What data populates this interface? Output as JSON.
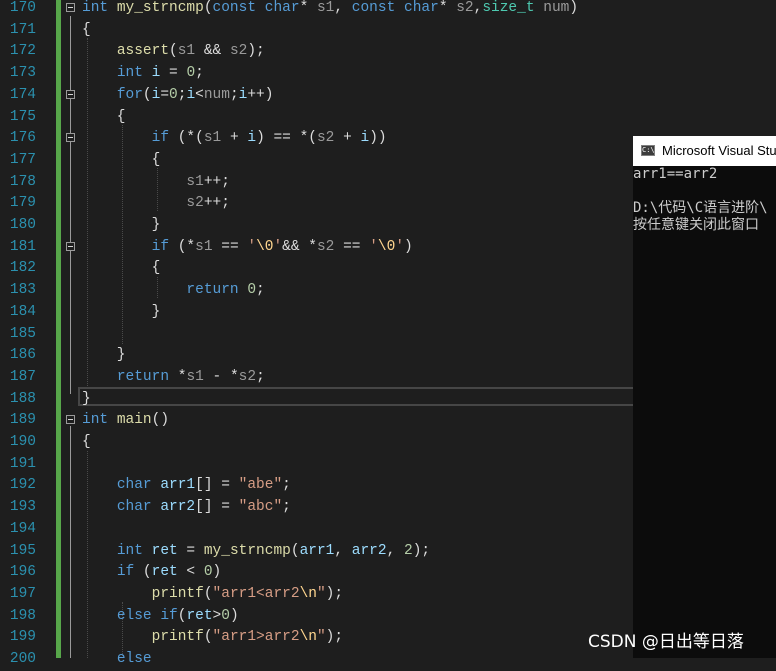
{
  "editor": {
    "lines": [
      {
        "num": "170",
        "parts": [
          [
            "kw",
            "int"
          ],
          [
            "t",
            " "
          ],
          [
            "fn",
            "my_strncmp"
          ],
          [
            "t",
            "("
          ],
          [
            "kw",
            "const"
          ],
          [
            "t",
            " "
          ],
          [
            "kw",
            "char"
          ],
          [
            "t",
            "* "
          ],
          [
            "pm",
            "s1"
          ],
          [
            "t",
            ", "
          ],
          [
            "kw",
            "const"
          ],
          [
            "t",
            " "
          ],
          [
            "kw",
            "char"
          ],
          [
            "t",
            "* "
          ],
          [
            "pm",
            "s2"
          ],
          [
            "t",
            ","
          ],
          [
            "tp",
            "size_t"
          ],
          [
            "t",
            " "
          ],
          [
            "pm",
            "num"
          ],
          [
            "t",
            ")"
          ]
        ]
      },
      {
        "num": "171",
        "parts": [
          [
            "t",
            "{"
          ]
        ]
      },
      {
        "num": "172",
        "parts": [
          [
            "t",
            "    "
          ],
          [
            "fn",
            "assert"
          ],
          [
            "t",
            "("
          ],
          [
            "pm",
            "s1"
          ],
          [
            "t",
            " && "
          ],
          [
            "pm",
            "s2"
          ],
          [
            "t",
            ");"
          ]
        ]
      },
      {
        "num": "173",
        "parts": [
          [
            "t",
            "    "
          ],
          [
            "kw",
            "int"
          ],
          [
            "t",
            " "
          ],
          [
            "vr",
            "i"
          ],
          [
            "t",
            " = "
          ],
          [
            "nm",
            "0"
          ],
          [
            "t",
            ";"
          ]
        ]
      },
      {
        "num": "174",
        "parts": [
          [
            "t",
            "    "
          ],
          [
            "kw",
            "for"
          ],
          [
            "t",
            "("
          ],
          [
            "vr",
            "i"
          ],
          [
            "t",
            "="
          ],
          [
            "nm",
            "0"
          ],
          [
            "t",
            ";"
          ],
          [
            "vr",
            "i"
          ],
          [
            "t",
            "<"
          ],
          [
            "pm",
            "num"
          ],
          [
            "t",
            ";"
          ],
          [
            "vr",
            "i"
          ],
          [
            "t",
            "++)"
          ]
        ]
      },
      {
        "num": "175",
        "parts": [
          [
            "t",
            "    {"
          ]
        ]
      },
      {
        "num": "176",
        "parts": [
          [
            "t",
            "        "
          ],
          [
            "kw",
            "if"
          ],
          [
            "t",
            " (*("
          ],
          [
            "pm",
            "s1"
          ],
          [
            "t",
            " + "
          ],
          [
            "vr",
            "i"
          ],
          [
            "t",
            ") == *("
          ],
          [
            "pm",
            "s2"
          ],
          [
            "t",
            " + "
          ],
          [
            "vr",
            "i"
          ],
          [
            "t",
            "))"
          ]
        ]
      },
      {
        "num": "177",
        "parts": [
          [
            "t",
            "        {"
          ]
        ]
      },
      {
        "num": "178",
        "parts": [
          [
            "t",
            "            "
          ],
          [
            "pm",
            "s1"
          ],
          [
            "t",
            "++;"
          ]
        ]
      },
      {
        "num": "179",
        "parts": [
          [
            "t",
            "            "
          ],
          [
            "pm",
            "s2"
          ],
          [
            "t",
            "++;"
          ]
        ]
      },
      {
        "num": "180",
        "parts": [
          [
            "t",
            "        }"
          ]
        ]
      },
      {
        "num": "181",
        "parts": [
          [
            "t",
            "        "
          ],
          [
            "kw",
            "if"
          ],
          [
            "t",
            " (*"
          ],
          [
            "pm",
            "s1"
          ],
          [
            "t",
            " == "
          ],
          [
            "st",
            "'"
          ],
          [
            "esc",
            "\\0"
          ],
          [
            "st",
            "'"
          ],
          [
            "t",
            "&& *"
          ],
          [
            "pm",
            "s2"
          ],
          [
            "t",
            " == "
          ],
          [
            "st",
            "'"
          ],
          [
            "esc",
            "\\0"
          ],
          [
            "st",
            "'"
          ],
          [
            "t",
            ")"
          ]
        ]
      },
      {
        "num": "182",
        "parts": [
          [
            "t",
            "        {"
          ]
        ]
      },
      {
        "num": "183",
        "parts": [
          [
            "t",
            "            "
          ],
          [
            "kw",
            "return"
          ],
          [
            "t",
            " "
          ],
          [
            "nm",
            "0"
          ],
          [
            "t",
            ";"
          ]
        ]
      },
      {
        "num": "184",
        "parts": [
          [
            "t",
            "        }"
          ]
        ]
      },
      {
        "num": "185",
        "parts": [
          [
            "t",
            ""
          ]
        ]
      },
      {
        "num": "186",
        "parts": [
          [
            "t",
            "    }"
          ]
        ]
      },
      {
        "num": "187",
        "parts": [
          [
            "t",
            "    "
          ],
          [
            "kw",
            "return"
          ],
          [
            "t",
            " *"
          ],
          [
            "pm",
            "s1"
          ],
          [
            "t",
            " - *"
          ],
          [
            "pm",
            "s2"
          ],
          [
            "t",
            ";"
          ]
        ]
      },
      {
        "num": "188",
        "parts": [
          [
            "t",
            "}"
          ]
        ]
      },
      {
        "num": "189",
        "parts": [
          [
            "kw",
            "int"
          ],
          [
            "t",
            " "
          ],
          [
            "fn",
            "main"
          ],
          [
            "t",
            "()"
          ]
        ]
      },
      {
        "num": "190",
        "parts": [
          [
            "t",
            "{"
          ]
        ]
      },
      {
        "num": "191",
        "parts": [
          [
            "t",
            ""
          ]
        ]
      },
      {
        "num": "192",
        "parts": [
          [
            "t",
            "    "
          ],
          [
            "kw",
            "char"
          ],
          [
            "t",
            " "
          ],
          [
            "vr",
            "arr1"
          ],
          [
            "t",
            "[] = "
          ],
          [
            "st",
            "\"abe\""
          ],
          [
            "t",
            ";"
          ]
        ]
      },
      {
        "num": "193",
        "parts": [
          [
            "t",
            "    "
          ],
          [
            "kw",
            "char"
          ],
          [
            "t",
            " "
          ],
          [
            "vr",
            "arr2"
          ],
          [
            "t",
            "[] = "
          ],
          [
            "st",
            "\"abc\""
          ],
          [
            "t",
            ";"
          ]
        ]
      },
      {
        "num": "194",
        "parts": [
          [
            "t",
            ""
          ]
        ]
      },
      {
        "num": "195",
        "parts": [
          [
            "t",
            "    "
          ],
          [
            "kw",
            "int"
          ],
          [
            "t",
            " "
          ],
          [
            "vr",
            "ret"
          ],
          [
            "t",
            " = "
          ],
          [
            "fn",
            "my_strncmp"
          ],
          [
            "t",
            "("
          ],
          [
            "vr",
            "arr1"
          ],
          [
            "t",
            ", "
          ],
          [
            "vr",
            "arr2"
          ],
          [
            "t",
            ", "
          ],
          [
            "nm",
            "2"
          ],
          [
            "t",
            ");"
          ]
        ]
      },
      {
        "num": "196",
        "parts": [
          [
            "t",
            "    "
          ],
          [
            "kw",
            "if"
          ],
          [
            "t",
            " ("
          ],
          [
            "vr",
            "ret"
          ],
          [
            "t",
            " < "
          ],
          [
            "nm",
            "0"
          ],
          [
            "t",
            ")"
          ]
        ]
      },
      {
        "num": "197",
        "parts": [
          [
            "t",
            "        "
          ],
          [
            "fn",
            "printf"
          ],
          [
            "t",
            "("
          ],
          [
            "st",
            "\"arr1<arr2"
          ],
          [
            "esc",
            "\\n"
          ],
          [
            "st",
            "\""
          ],
          [
            "t",
            ");"
          ]
        ]
      },
      {
        "num": "198",
        "parts": [
          [
            "t",
            "    "
          ],
          [
            "kw",
            "else"
          ],
          [
            "t",
            " "
          ],
          [
            "kw",
            "if"
          ],
          [
            "t",
            "("
          ],
          [
            "vr",
            "ret"
          ],
          [
            "t",
            ">"
          ],
          [
            "nm",
            "0"
          ],
          [
            "t",
            ")"
          ]
        ]
      },
      {
        "num": "199",
        "parts": [
          [
            "t",
            "        "
          ],
          [
            "fn",
            "printf"
          ],
          [
            "t",
            "("
          ],
          [
            "st",
            "\"arr1>arr2"
          ],
          [
            "esc",
            "\\n"
          ],
          [
            "st",
            "\""
          ],
          [
            "t",
            ");"
          ]
        ]
      },
      {
        "num": "200",
        "parts": [
          [
            "t",
            "    "
          ],
          [
            "kw",
            "else"
          ]
        ]
      }
    ]
  },
  "console": {
    "title": "Microsoft Visual Studio",
    "icon": "console-app-icon",
    "lines": [
      "arr1==arr2",
      "",
      "D:\\代码\\C语言进阶\\",
      "按任意键关闭此窗口"
    ]
  },
  "watermark": "CSDN @日出等日落",
  "colors": {
    "background": "#1e1e1e",
    "keyword": "#569cd6",
    "function": "#dcdcaa",
    "parameter": "#9a9a9a",
    "variable": "#9cdcfe",
    "string": "#d69d85",
    "number": "#b5cea8",
    "type": "#4ec9b0",
    "line_number": "#2b91af",
    "change_bar": "#57a64a"
  }
}
